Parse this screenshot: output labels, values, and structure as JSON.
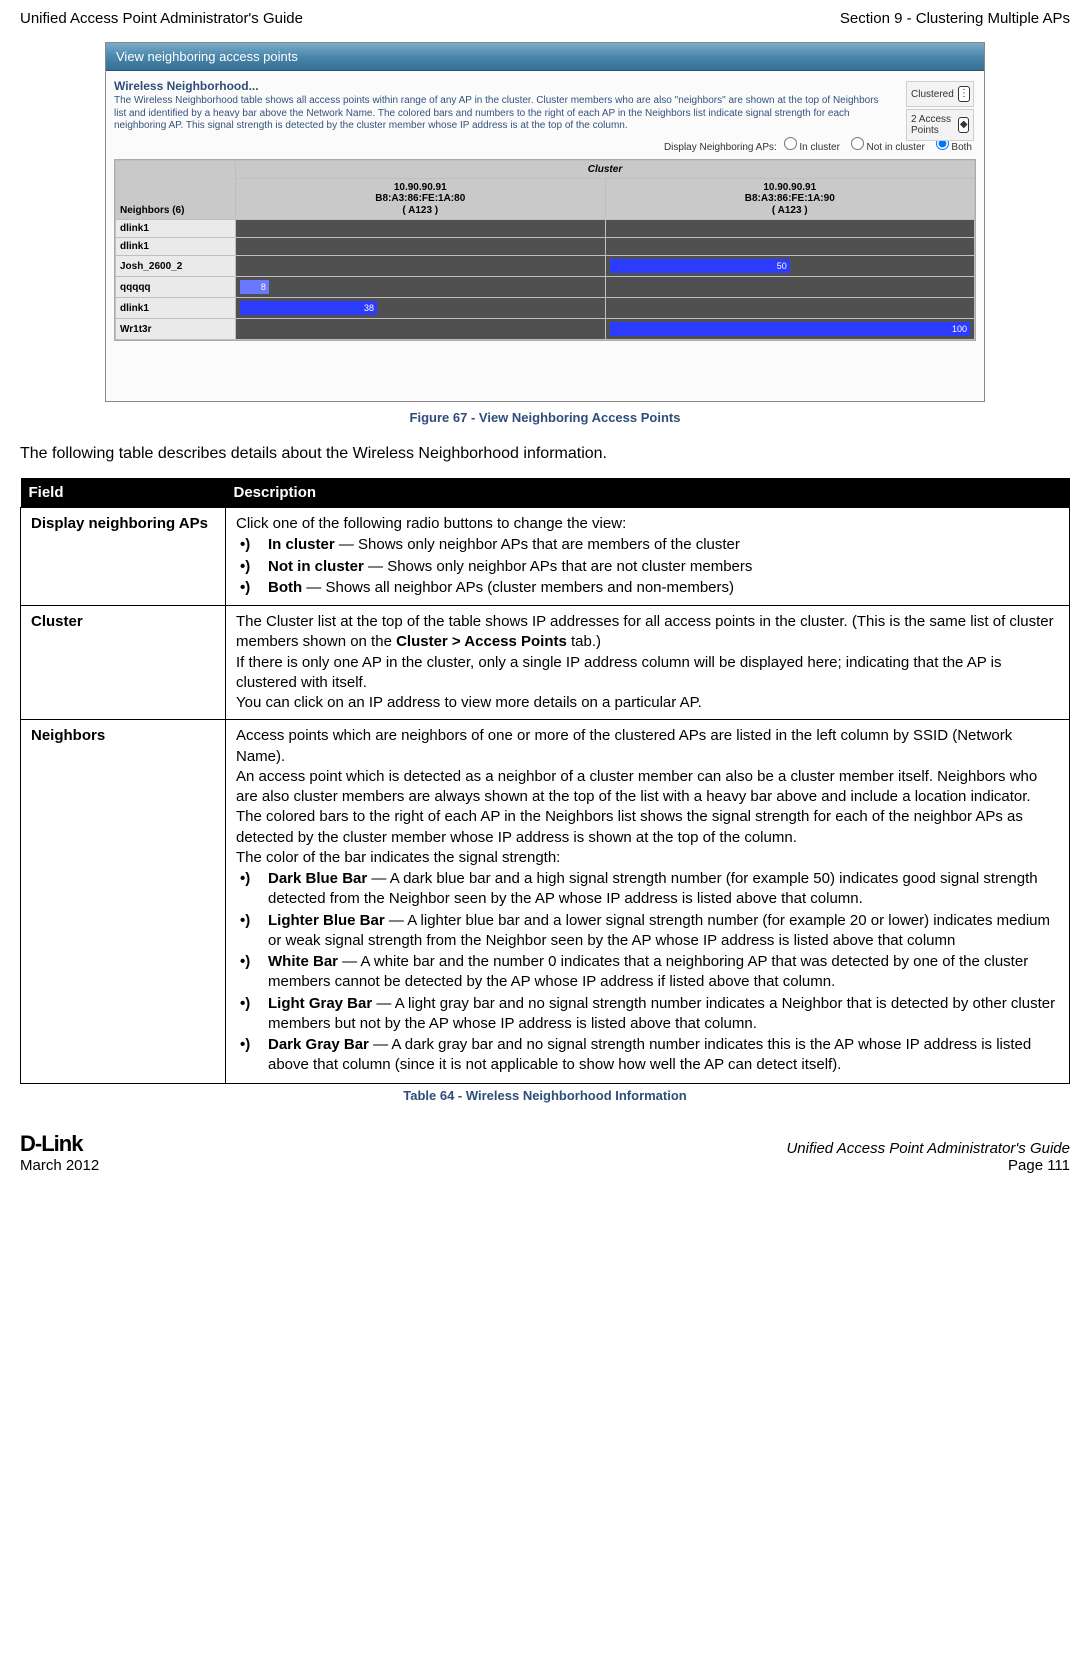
{
  "header": {
    "left": "Unified Access Point Administrator's Guide",
    "right": "Section 9 - Clustering Multiple APs"
  },
  "shot": {
    "title": "View neighboring access points",
    "heading": "Wireless Neighborhood...",
    "desc": "The Wireless Neighborhood table shows all access points within range of any AP in the cluster. Cluster members who are also \"neighbors\" are shown at the top of Neighbors list and identified by a heavy bar above the Network Name. The colored bars and numbers to the right of each AP in the Neighbors list indicate signal strength for each neighboring AP. This signal strength is detected by the cluster member whose IP address is at the top of the column.",
    "rpanel": {
      "clustered": "Clustered",
      "aps": "2 Access Points"
    },
    "filter": {
      "label": "Display Neighboring APs:",
      "opt1": "In cluster",
      "opt2": "Not in cluster",
      "opt3": "Both"
    },
    "cluster_label": "Cluster",
    "neighbors_header": "Neighbors (6)",
    "cols": [
      {
        "ip": "10.90.90.91",
        "mac": "B8:A3:86:FE:1A:80",
        "loc": "( A123 )"
      },
      {
        "ip": "10.90.90.91",
        "mac": "B8:A3:86:FE:1A:90",
        "loc": "( A123 )"
      }
    ],
    "rows": [
      {
        "name": "dlink1",
        "v": [
          "",
          ""
        ]
      },
      {
        "name": "dlink1",
        "v": [
          "",
          ""
        ]
      },
      {
        "name": "Josh_2600_2",
        "v": [
          "",
          "50"
        ]
      },
      {
        "name": "qqqqq",
        "v": [
          "8",
          ""
        ]
      },
      {
        "name": "dlink1",
        "v": [
          "38",
          ""
        ]
      },
      {
        "name": "Wr1t3r",
        "v": [
          "",
          "100"
        ]
      }
    ]
  },
  "fig_caption": "Figure 67 - View Neighboring Access Points",
  "lead": "The following table describes details about the Wireless Neighborhood information.",
  "table": {
    "h1": "Field",
    "h2": "Description",
    "row1": {
      "field": "Display neighboring APs",
      "intro": "Click one of the following radio buttons to change the view:",
      "b1a": "In cluster",
      "b1b": " — Shows only neighbor APs that are members of the cluster",
      "b2a": "Not in cluster",
      "b2b": " — Shows only neighbor APs that are not cluster members",
      "b3a": "Both",
      "b3b": " — Shows all neighbor APs (cluster members and non-members)"
    },
    "row2": {
      "field": "Cluster",
      "p1a": "The Cluster list at the top of the table shows IP addresses for all access points in the cluster. (This is the same list of cluster members shown on the ",
      "p1b": "Cluster > Access Points",
      "p1c": " tab.)",
      "p2": "If there is only one AP in the cluster, only a single IP address column will be displayed here; indicating that the AP is clustered with itself.",
      "p3": "You can click on an IP address to view more details on a particular AP."
    },
    "row3": {
      "field": "Neighbors",
      "p1": "Access points which are neighbors of one or more of the clustered APs are listed in the left column by SSID (Network Name).",
      "p2": "An access point which is detected as a neighbor of a cluster member can also be a cluster member itself. Neighbors who are also cluster members are always shown at the top of the list with a heavy bar above and include a location indicator.",
      "p3": "The colored bars to the right of each AP in the Neighbors list shows the signal strength for each of the neighbor APs as detected by the cluster member whose IP address is shown at the top of the column.",
      "p4": "The color of the bar indicates the signal strength:",
      "b1a": "Dark Blue Bar",
      "b1b": " — A dark blue bar and a high signal strength number (for example 50) indicates good signal strength detected from the Neighbor seen by the AP whose IP address is listed above that column.",
      "b2a": "Lighter Blue Bar",
      "b2b": " — A lighter blue bar and a lower signal strength number (for example 20 or lower) indicates medium or weak signal strength from the Neighbor seen by the AP whose IP address is listed above that column",
      "b3a": "White Bar",
      "b3b": " — A white bar and the number 0 indicates that a neighboring AP that was detected by one of the cluster members cannot be detected by the AP whose IP address if listed above that column.",
      "b4a": "Light Gray Bar",
      "b4b": " — A light gray bar and no signal strength number indicates a Neighbor that is detected by other cluster members but not by the AP whose IP address is listed above that column.",
      "b5a": "Dark Gray Bar",
      "b5b": " — A dark gray bar and no signal strength number indicates this is the AP whose IP address is listed above that column (since it is not applicable to show how well the AP can detect itself)."
    }
  },
  "tbl_caption": "Table 64 - Wireless Neighborhood Information",
  "footer": {
    "logo": "D-Link",
    "date": "March 2012",
    "right1": "Unified Access Point Administrator's Guide",
    "right2": "Page 111"
  }
}
